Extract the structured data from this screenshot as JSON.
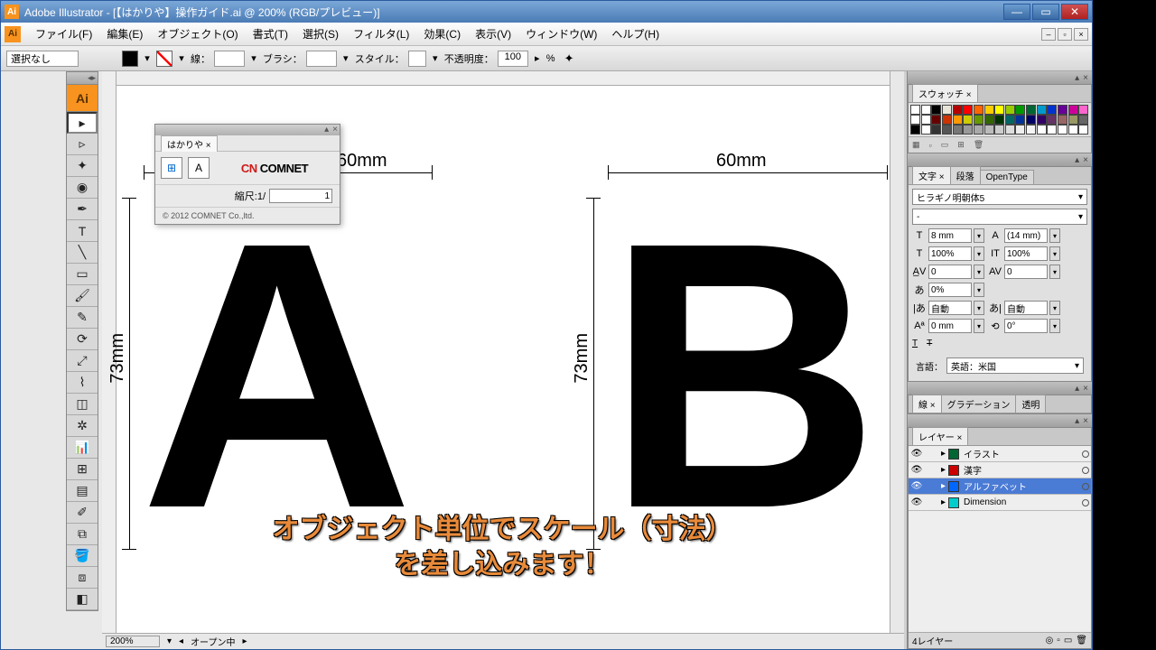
{
  "title": "Adobe Illustrator - [【はかりや】操作ガイド.ai @ 200% (RGB/プレビュー)]",
  "menu": [
    "ファイル(F)",
    "編集(E)",
    "オブジェクト(O)",
    "書式(T)",
    "選択(S)",
    "フィルタ(L)",
    "効果(C)",
    "表示(V)",
    "ウィンドウ(W)",
    "ヘルプ(H)"
  ],
  "control": {
    "selection": "選択なし",
    "stroke_label": "線：",
    "brush_label": "ブラシ：",
    "style_label": "スタイル：",
    "opacity_label": "不透明度：",
    "opacity_value": "100",
    "opacity_unit": "%"
  },
  "plugin": {
    "tab": "はかりや ×",
    "scale_label": "縮尺:1/",
    "scale_value": "1",
    "logo_a": "CN",
    "logo_b": "COMNET",
    "copyright": "© 2012 COMNET Co.,ltd."
  },
  "canvas": {
    "letterA": "A",
    "letterB": "B",
    "dimA_w": "60mm",
    "dimB_w": "60mm",
    "dimA_h": "73mm",
    "dimB_h": "73mm"
  },
  "subtitle_l1": "オブジェクト単位でスケール（寸法）",
  "subtitle_l2": "を差し込みます！",
  "swatches_tab": "スウォッチ ×",
  "swatch_colors": [
    "#ffffff",
    "#ffffff",
    "#000000",
    "#e8e5d8",
    "#b30000",
    "#ff0000",
    "#ff6600",
    "#ffcc00",
    "#ffff00",
    "#99cc00",
    "#009900",
    "#006633",
    "#0099cc",
    "#0033cc",
    "#660099",
    "#cc0099",
    "#ff66cc",
    "#ffffff",
    "#ffffff",
    "#660000",
    "#cc3300",
    "#ff9900",
    "#cccc00",
    "#669900",
    "#336600",
    "#003300",
    "#006666",
    "#003399",
    "#000066",
    "#330066",
    "#663366",
    "#996666",
    "#999966",
    "#666666",
    "#000000",
    "#ffffff",
    "#333333",
    "#555555",
    "#777777",
    "#999999",
    "#aaaaaa",
    "#bbbbbb",
    "#cccccc",
    "#dddddd",
    "#eeeeee",
    "#f5f5f5",
    "#ffffff",
    "#ffffff",
    "#ffffff",
    "#ffffff",
    "#ffffff"
  ],
  "char_tabs": [
    "文字 ×",
    "段落",
    "OpenType"
  ],
  "char": {
    "font": "ヒラギノ明朝体5",
    "variant": "-",
    "size": "8 mm",
    "leading": "(14 mm)",
    "hscale": "100%",
    "vscale": "100%",
    "tracking": "0",
    "kerning": "0",
    "tsume": "0%",
    "aki_l": "自動",
    "aki_r": "自動",
    "baseline": "0 mm",
    "rotation": "0°",
    "lang_label": "言語：",
    "lang": "英語：米国"
  },
  "stroke_tabs": [
    "線 ×",
    "グラデーション",
    "透明"
  ],
  "layers_tab": "レイヤー ×",
  "layers": [
    {
      "name": "イラスト",
      "color": "#006633"
    },
    {
      "name": "漢字",
      "color": "#cc0000"
    },
    {
      "name": "アルファベット",
      "color": "#0066ff",
      "selected": true
    },
    {
      "name": "Dimension",
      "color": "#00cccc"
    }
  ],
  "layers_count": "4レイヤー",
  "status": {
    "zoom": "200%",
    "mode": "オープン中"
  }
}
